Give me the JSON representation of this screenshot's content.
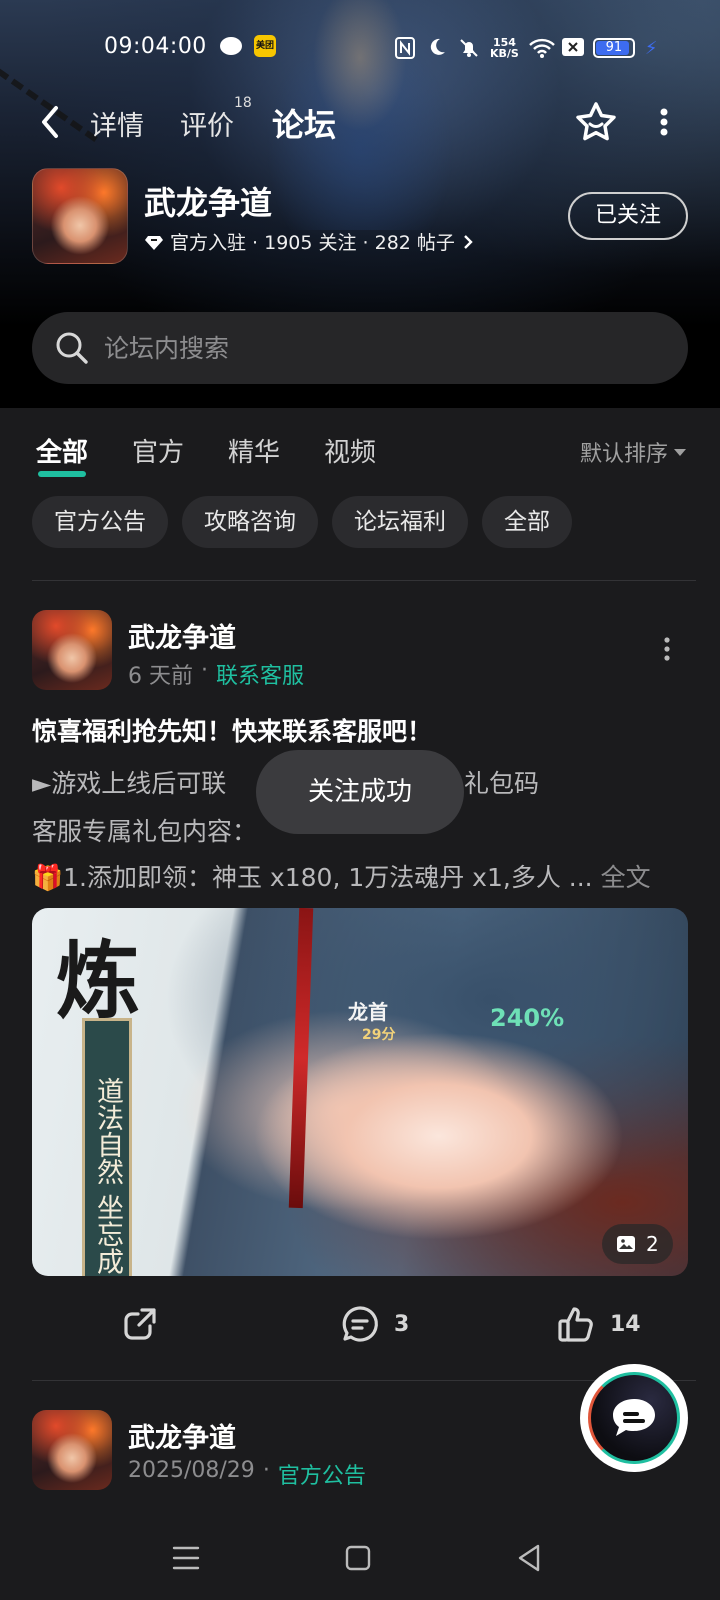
{
  "status_bar": {
    "time": "09:04:00",
    "meituan_label": "美团",
    "net_speed_value": "154",
    "net_speed_unit": "KB/S",
    "battery": "91",
    "icons": [
      "wechat-icon",
      "meituan-icon",
      "nfc-icon",
      "moon-icon",
      "mute-icon",
      "wifi-icon",
      "sim-icon",
      "battery-icon",
      "charging-icon"
    ]
  },
  "nav": {
    "tabs": [
      {
        "label": "详情"
      },
      {
        "label": "评价",
        "badge": "18"
      },
      {
        "label": "论坛"
      }
    ],
    "active_tab": "论坛"
  },
  "game": {
    "name": "武龙争道",
    "meta": "官方入驻 · 1905 关注 · 282 帖子",
    "follow_label": "已关注"
  },
  "search": {
    "placeholder": "论坛内搜索"
  },
  "filter": {
    "tabs": [
      "全部",
      "官方",
      "精华",
      "视频"
    ],
    "active": "全部",
    "sort_label": "默认排序",
    "chips": [
      "官方公告",
      "攻略咨询",
      "论坛福利",
      "全部"
    ]
  },
  "posts": [
    {
      "author": "武龙争道",
      "time": "6 天前",
      "tag": "联系客服",
      "title": "惊喜福利抢先知！快来联系客服吧！",
      "lines": [
        "►游戏上线后可联",
        "礼包码",
        "客服专属礼包内容：",
        "🎁1.添加即领：神玉 x180, 1万法魂丹 x1,多人 ..."
      ],
      "more_label": "全文",
      "image": {
        "big_char": "炼",
        "scroll_text": "道法自然 坐忘成",
        "hud_text": "龙首",
        "hud_timer": "29分",
        "hud_percent": "240%"
      },
      "image_count": "2",
      "comments": "3",
      "likes": "14"
    },
    {
      "author": "武龙争道",
      "time": "2025/08/29",
      "tag": "官方公告"
    }
  ],
  "toast": "关注成功",
  "colors": {
    "accent": "#1fbfa0",
    "background": "#1b1b1d",
    "chip_bg": "#2b2b2e"
  }
}
